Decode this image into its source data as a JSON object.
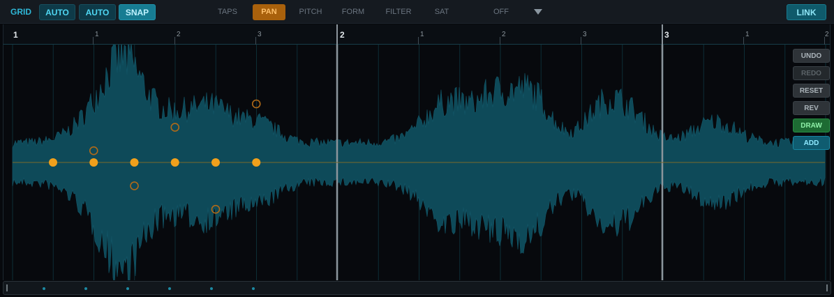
{
  "toolbar": {
    "grid_label": "GRID",
    "auto1_label": "AUTO",
    "auto2_label": "AUTO",
    "snap_label": "SNAP",
    "modes": [
      {
        "label": "TAPS",
        "active": false
      },
      {
        "label": "PAN",
        "active": true
      },
      {
        "label": "PITCH",
        "active": false
      },
      {
        "label": "FORM",
        "active": false
      },
      {
        "label": "FILTER",
        "active": false
      },
      {
        "label": "SAT",
        "active": false
      }
    ],
    "off_label": "OFF",
    "link_label": "LINK",
    "dropdown_icon": "triangle-down-icon"
  },
  "ruler": {
    "bars": [
      {
        "label": "1",
        "beats": [
          "1",
          "2",
          "3"
        ]
      },
      {
        "label": "2",
        "beats": [
          "1",
          "2",
          "3"
        ]
      },
      {
        "label": "3",
        "beats": [
          "1",
          "2"
        ]
      }
    ]
  },
  "side_buttons": [
    {
      "label": "UNDO",
      "state": "normal"
    },
    {
      "label": "REDO",
      "state": "disabled"
    },
    {
      "label": "RESET",
      "state": "normal"
    },
    {
      "label": "REV",
      "state": "normal"
    },
    {
      "label": "DRAW",
      "state": "draw"
    },
    {
      "label": "ADD",
      "state": "add"
    }
  ],
  "colors": {
    "waveform": "#0e4a59",
    "waveform_peak": "#13586a",
    "center_line": "#7a6a2a",
    "tap_fill": "#f0a01c",
    "pan_ring": "#b06a18",
    "grid_line": "#0d2e36",
    "bar_line": "#8c959c",
    "accent": "#2fb8d8"
  },
  "taps": {
    "count": 6,
    "pan_values": [
      0,
      0.3,
      -0.6,
      0.9,
      -1.2,
      1.5
    ]
  }
}
